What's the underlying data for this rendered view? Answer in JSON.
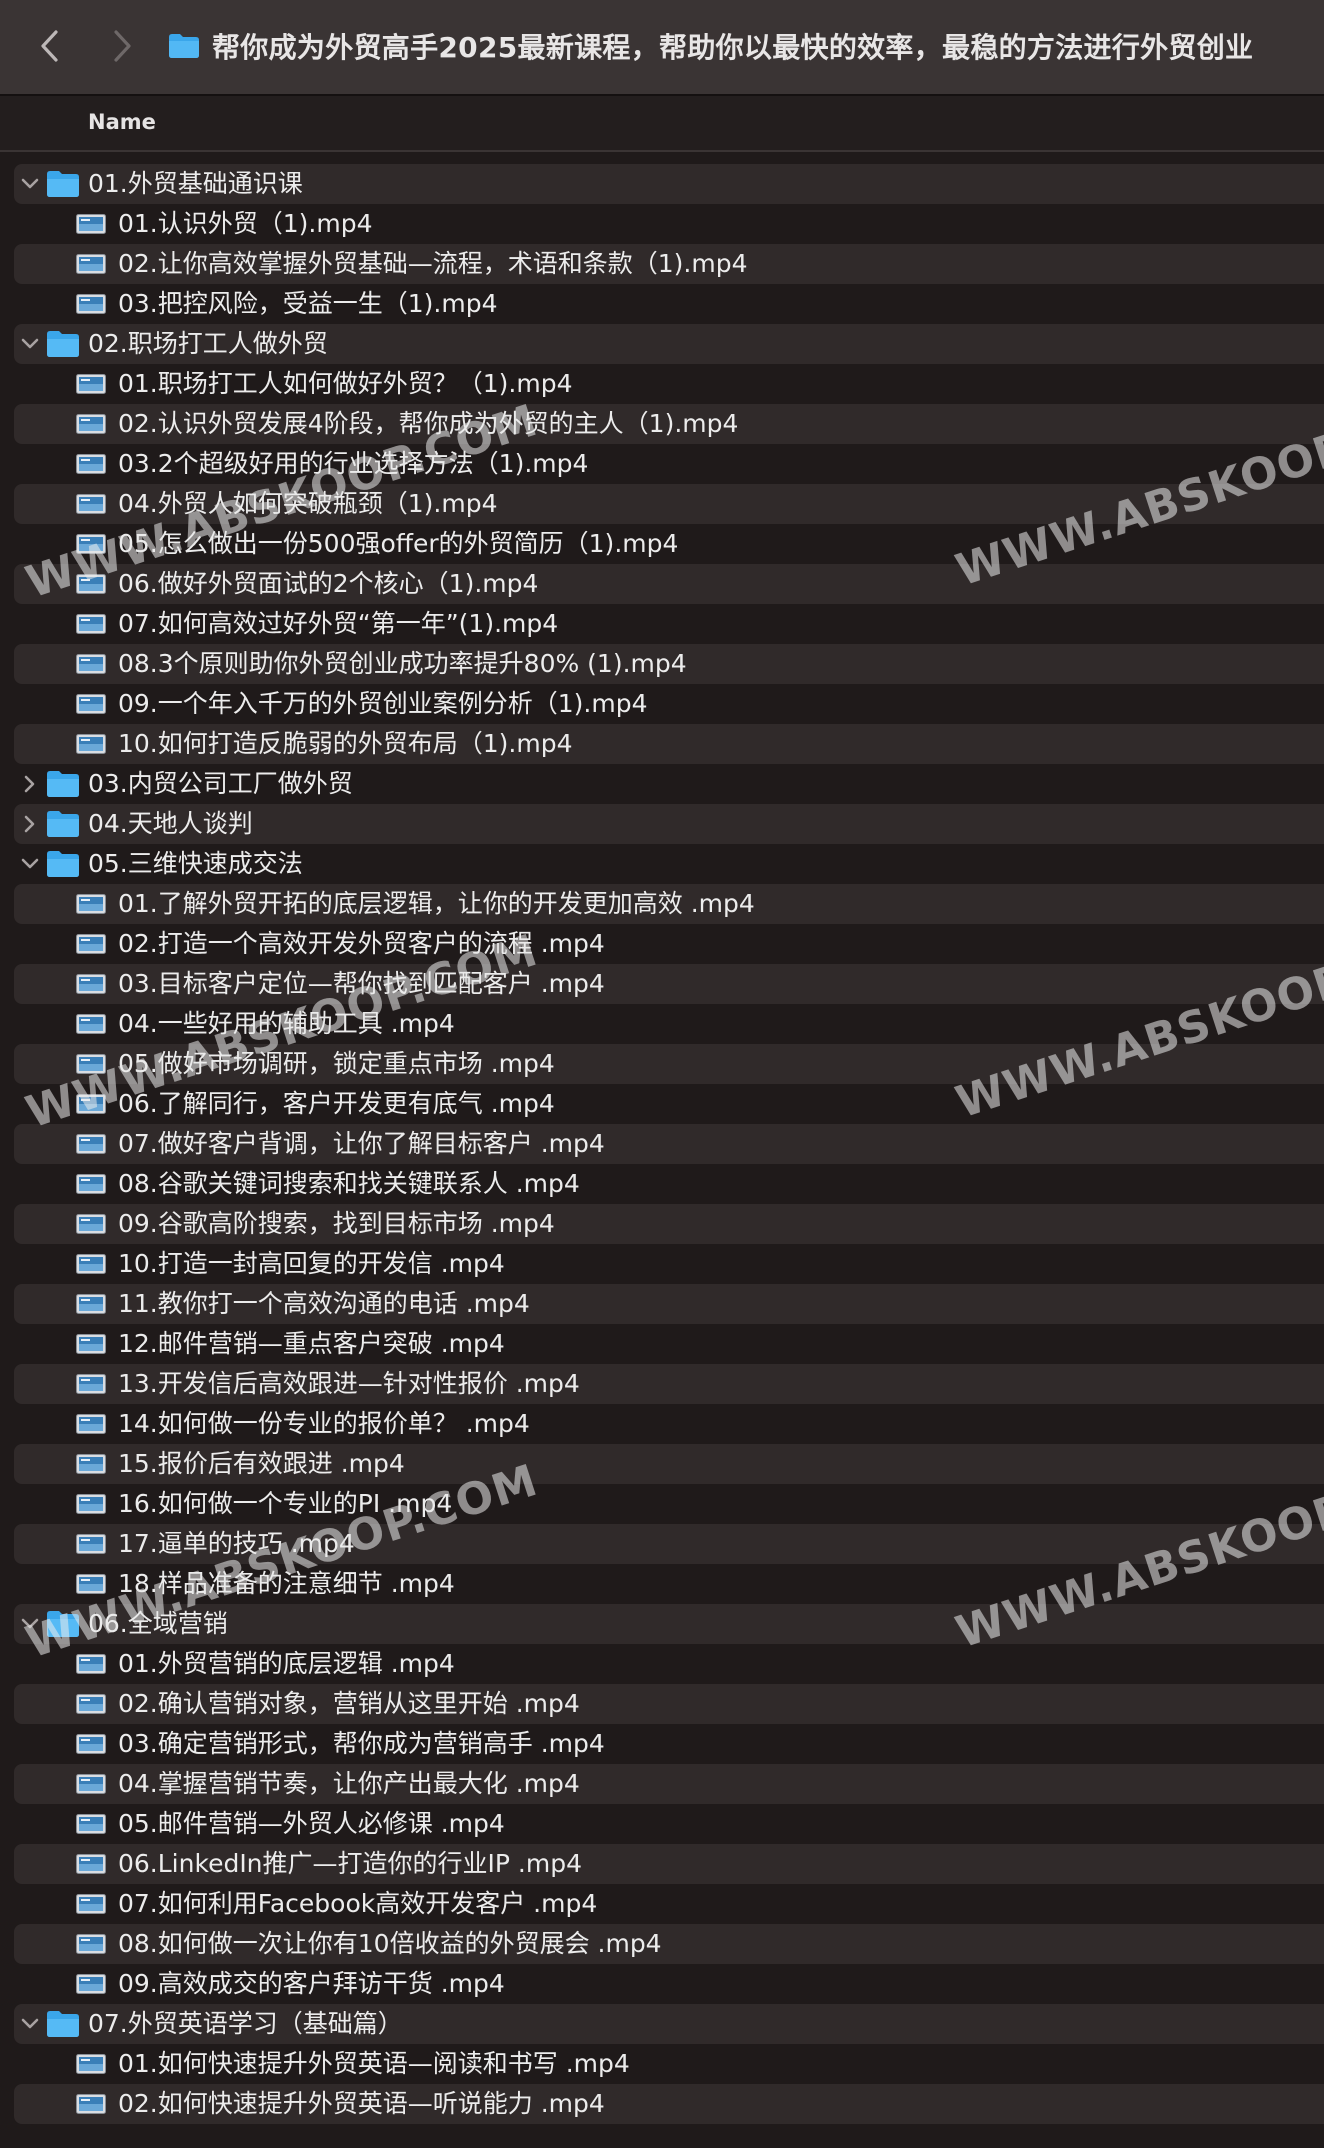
{
  "window": {
    "title": "帮你成为外贸高手2025最新课程，帮助你以最快的效率，最稳的方法进行外贸创业"
  },
  "columns": {
    "name": "Name"
  },
  "watermark": "WWW.ABSKOOP.COM",
  "rows": [
    {
      "kind": "folder",
      "label": "01.外贸基础通识课",
      "expanded": true
    },
    {
      "kind": "file",
      "label": "01.认识外贸（1).mp4"
    },
    {
      "kind": "file",
      "label": "02.让你高效掌握外贸基础—流程，术语和条款（1).mp4"
    },
    {
      "kind": "file",
      "label": "03.把控风险，受益一生（1).mp4"
    },
    {
      "kind": "folder",
      "label": "02.职场打工人做外贸",
      "expanded": true
    },
    {
      "kind": "file",
      "label": "01.职场打工人如何做好外贸？（1).mp4"
    },
    {
      "kind": "file",
      "label": "02.认识外贸发展4阶段，帮你成为外贸的主人（1).mp4"
    },
    {
      "kind": "file",
      "label": "03.2个超级好用的行业选择方法（1).mp4"
    },
    {
      "kind": "file",
      "label": "04.外贸人如何突破瓶颈（1).mp4"
    },
    {
      "kind": "file",
      "label": "05.怎么做出一份500强offer的外贸简历（1).mp4"
    },
    {
      "kind": "file",
      "label": "06.做好外贸面试的2个核心（1).mp4"
    },
    {
      "kind": "file",
      "label": "07.如何高效过好外贸“第一年”(1).mp4"
    },
    {
      "kind": "file",
      "label": "08.3个原则助你外贸创业成功率提升80% (1).mp4"
    },
    {
      "kind": "file",
      "label": "09.一个年入千万的外贸创业案例分析（1).mp4"
    },
    {
      "kind": "file",
      "label": "10.如何打造反脆弱的外贸布局（1).mp4"
    },
    {
      "kind": "folder",
      "label": "03.内贸公司工厂做外贸",
      "expanded": false
    },
    {
      "kind": "folder",
      "label": "04.天地人谈判",
      "expanded": false
    },
    {
      "kind": "folder",
      "label": "05.三维快速成交法",
      "expanded": true
    },
    {
      "kind": "file",
      "label": "01.了解外贸开拓的底层逻辑，让你的开发更加高效 .mp4"
    },
    {
      "kind": "file",
      "label": "02.打造一个高效开发外贸客户的流程 .mp4"
    },
    {
      "kind": "file",
      "label": "03.目标客户定位—帮你找到匹配客户 .mp4"
    },
    {
      "kind": "file",
      "label": "04.一些好用的辅助工具 .mp4"
    },
    {
      "kind": "file",
      "label": "05.做好市场调研，锁定重点市场 .mp4"
    },
    {
      "kind": "file",
      "label": "06.了解同行，客户开发更有底气 .mp4"
    },
    {
      "kind": "file",
      "label": "07.做好客户背调，让你了解目标客户 .mp4"
    },
    {
      "kind": "file",
      "label": "08.谷歌关键词搜索和找关键联系人 .mp4"
    },
    {
      "kind": "file",
      "label": "09.谷歌高阶搜索，找到目标市场 .mp4"
    },
    {
      "kind": "file",
      "label": "10.打造一封高回复的开发信 .mp4"
    },
    {
      "kind": "file",
      "label": "11.教你打一个高效沟通的电话 .mp4"
    },
    {
      "kind": "file",
      "label": "12.邮件营销—重点客户突破 .mp4"
    },
    {
      "kind": "file",
      "label": "13.开发信后高效跟进—针对性报价 .mp4"
    },
    {
      "kind": "file",
      "label": "14.如何做一份专业的报价单？ .mp4"
    },
    {
      "kind": "file",
      "label": "15.报价后有效跟进 .mp4"
    },
    {
      "kind": "file",
      "label": "16.如何做一个专业的PI .mp4"
    },
    {
      "kind": "file",
      "label": "17.逼单的技巧 .mp4"
    },
    {
      "kind": "file",
      "label": "18.样品准备的注意细节 .mp4"
    },
    {
      "kind": "folder",
      "label": "06.全域营销",
      "expanded": true
    },
    {
      "kind": "file",
      "label": "01.外贸营销的底层逻辑 .mp4"
    },
    {
      "kind": "file",
      "label": "02.确认营销对象，营销从这里开始 .mp4"
    },
    {
      "kind": "file",
      "label": "03.确定营销形式，帮你成为营销高手 .mp4"
    },
    {
      "kind": "file",
      "label": "04.掌握营销节奏，让你产出最大化 .mp4"
    },
    {
      "kind": "file",
      "label": "05.邮件营销—外贸人必修课 .mp4"
    },
    {
      "kind": "file",
      "label": "06.LinkedIn推广—打造你的行业IP .mp4"
    },
    {
      "kind": "file",
      "label": "07.如何利用Facebook高效开发客户 .mp4"
    },
    {
      "kind": "file",
      "label": "08.如何做一次让你有10倍收益的外贸展会 .mp4"
    },
    {
      "kind": "file",
      "label": "09.高效成交的客户拜访干货 .mp4"
    },
    {
      "kind": "folder",
      "label": "07.外贸英语学习（基础篇）",
      "expanded": true
    },
    {
      "kind": "file",
      "label": "01.如何快速提升外贸英语—阅读和书写 .mp4"
    },
    {
      "kind": "file",
      "label": "02.如何快速提升外贸英语—听说能力 .mp4"
    }
  ]
}
